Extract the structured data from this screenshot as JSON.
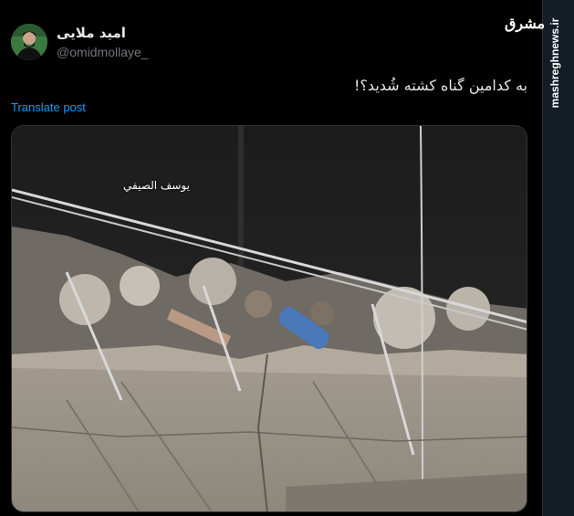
{
  "author": {
    "name": "امید ملایی",
    "handle": "@omidmollaye_"
  },
  "post": {
    "text": "به کدامین گناه کشته شُدید؟!",
    "translate_label": "Translate post"
  },
  "media": {
    "caption": "يوسف الصيفي"
  },
  "branding": {
    "logo": "مشرق",
    "site": "mashreghnews.ir"
  },
  "colors": {
    "link": "#1d9bf0",
    "background": "#000000",
    "secondary_text": "#71767b"
  }
}
